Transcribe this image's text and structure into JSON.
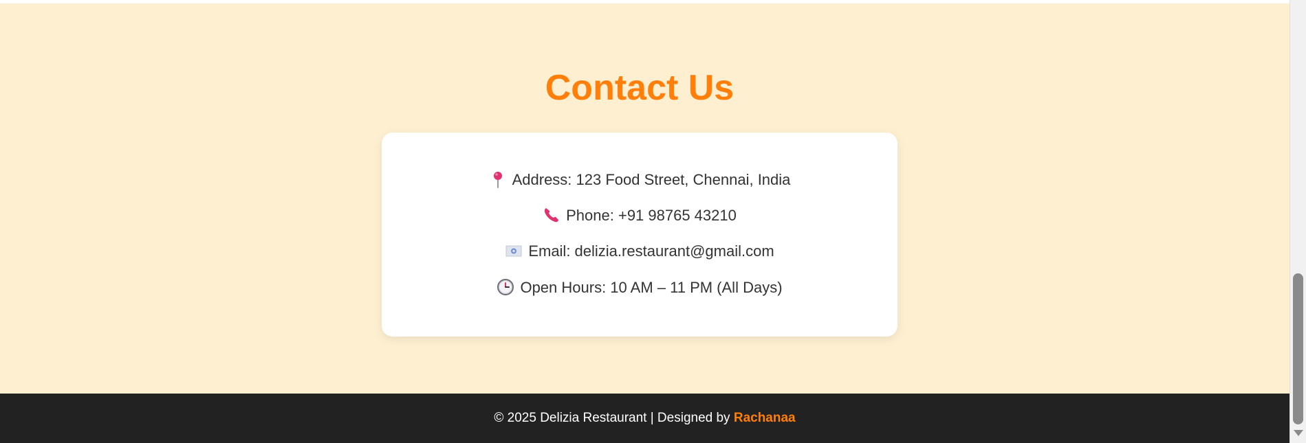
{
  "contact": {
    "title": "Contact Us",
    "address": "Address: 123 Food Street, Chennai, India",
    "phone": "Phone: +91 98765 43210",
    "email": "Email: delizia.restaurant@gmail.com",
    "hours": "Open Hours: 10 AM – 11 PM (All Days)",
    "icons": {
      "address": "round-pushpin-icon",
      "phone": "telephone-receiver-icon",
      "email": "email-envelope-icon",
      "hours": "clock-icon"
    }
  },
  "footer": {
    "text": "© 2025 Delizia Restaurant | Designed by ",
    "author": "Rachanaa"
  },
  "colors": {
    "accent": "#ff7f0a",
    "section_bg": "#fdefd0",
    "card_bg": "#ffffff",
    "footer_bg": "#222222",
    "icon_pink": "#e0326e"
  }
}
